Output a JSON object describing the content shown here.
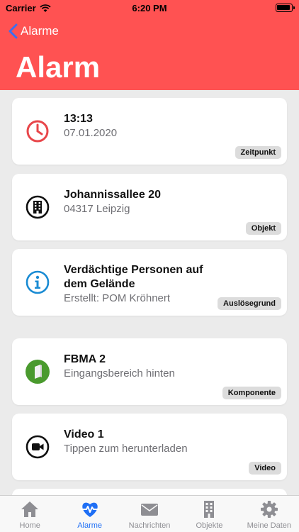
{
  "status": {
    "carrier": "Carrier",
    "time": "6:20 PM"
  },
  "nav": {
    "back_label": "Alarme",
    "title": "Alarm"
  },
  "cards": [
    {
      "icon": "clock-icon",
      "title": "13:13",
      "subtitle": "07.01.2020",
      "tag": "Zeitpunkt"
    },
    {
      "icon": "building-icon",
      "title": "Johannissallee 20",
      "subtitle": "04317 Leipzig",
      "tag": "Objekt"
    },
    {
      "icon": "info-icon",
      "title_line1": "Verdächtige Personen auf",
      "title_line2": "dem Gelände",
      "subtitle": "Erstellt: POM Kröhnert",
      "tag": "Auslösegrund"
    },
    {
      "icon": "detector-icon",
      "title": "FBMA 2",
      "subtitle": "Eingangsbereich hinten",
      "tag": "Komponente"
    },
    {
      "icon": "video-icon",
      "title": "Video 1",
      "subtitle": "Tippen zum herunterladen",
      "tag": "Video"
    }
  ],
  "tabs": [
    {
      "icon": "home-icon",
      "label": "Home"
    },
    {
      "icon": "heartbeat-icon",
      "label": "Alarme"
    },
    {
      "icon": "envelope-icon",
      "label": "Nachrichten"
    },
    {
      "icon": "building-icon",
      "label": "Objekte"
    },
    {
      "icon": "gear-icon",
      "label": "Meine Daten"
    }
  ],
  "colors": {
    "header": "#ff5252",
    "active_tab": "#1f6ff5",
    "clock": "#e8464a",
    "info": "#1a8bd3",
    "detector": "#4a9a2e"
  }
}
